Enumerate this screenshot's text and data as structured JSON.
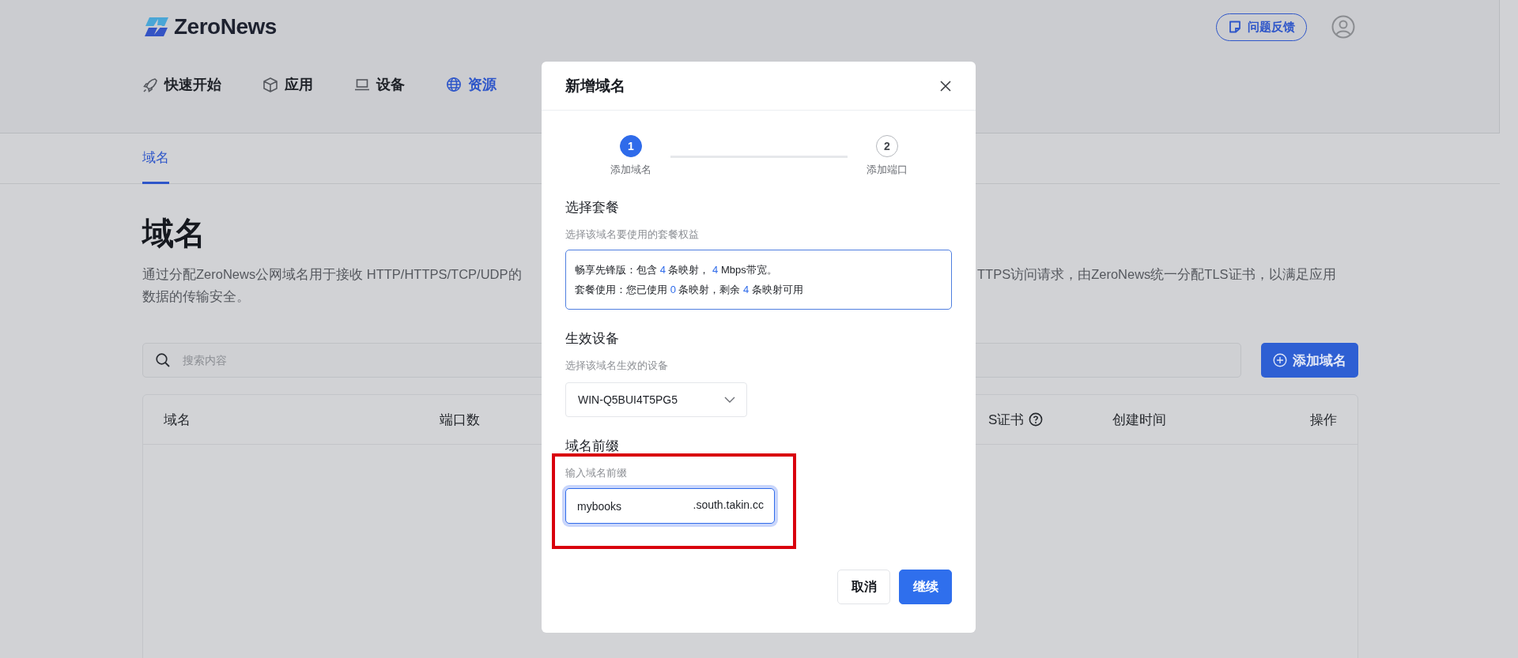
{
  "header": {
    "logo": "ZeroNews",
    "feedback_button": "问题反馈"
  },
  "nav": [
    {
      "label": "快速开始",
      "selected": false
    },
    {
      "label": "应用",
      "selected": false
    },
    {
      "label": "设备",
      "selected": false
    },
    {
      "label": "资源",
      "selected": true
    }
  ],
  "tabs": [
    {
      "label": "域名",
      "selected": true
    }
  ],
  "page": {
    "title": "域名",
    "description_left": "通过分配ZeroNews公网域名用于接收 HTTP/HTTPS/TCP/UDP的",
    "description_right": "TTPS访问请求，由ZeroNews统一分配TLS证书，以满足应用",
    "description_line_2": "数据的传输安全。"
  },
  "search": {
    "placeholder": "搜索内容"
  },
  "add_button": "添加域名",
  "table": {
    "columns": [
      {
        "label": "域名",
        "help": false
      },
      {
        "label": "端口数",
        "help": false
      },
      {
        "label": "S证书",
        "help": true
      },
      {
        "label": "创建时间",
        "help": false
      },
      {
        "label": "操作",
        "help": false
      }
    ]
  },
  "dialog": {
    "title": "新增域名",
    "steps": [
      {
        "number": "1",
        "label": "添加域名",
        "selected": true
      },
      {
        "number": "2",
        "label": "添加端口",
        "selected": false
      }
    ],
    "sections": [
      {
        "kind": "plan",
        "title": "选择套餐",
        "hint": "选择该域名要使用的套餐权益",
        "lines": [
          [
            {
              "text": "畅享先锋版：包含 ",
              "highlight": false
            },
            {
              "text": "4",
              "highlight": true
            },
            {
              "text": " 条映射， ",
              "highlight": false
            },
            {
              "text": "4",
              "highlight": true
            },
            {
              "text": " Mbps带宽。",
              "highlight": false
            }
          ],
          [
            {
              "text": "套餐使用：您已使用 ",
              "highlight": false
            },
            {
              "text": "0",
              "highlight": true
            },
            {
              "text": " 条映射，剩余 ",
              "highlight": false
            },
            {
              "text": "4",
              "highlight": true
            },
            {
              "text": " 条映射可用",
              "highlight": false
            }
          ]
        ]
      },
      {
        "kind": "select",
        "title": "生效设备",
        "hint": "选择该域名生效的设备",
        "value": "WIN-Q5BUI4T5PG5"
      },
      {
        "kind": "input",
        "title": "域名前缀",
        "hint": "输入域名前缀",
        "value": "mybooks",
        "suffix": ".south.takin.cc",
        "focused": true
      }
    ],
    "buttons": [
      {
        "label": "取消",
        "kind": "secondary"
      },
      {
        "label": "继续",
        "kind": "primary"
      }
    ]
  }
}
